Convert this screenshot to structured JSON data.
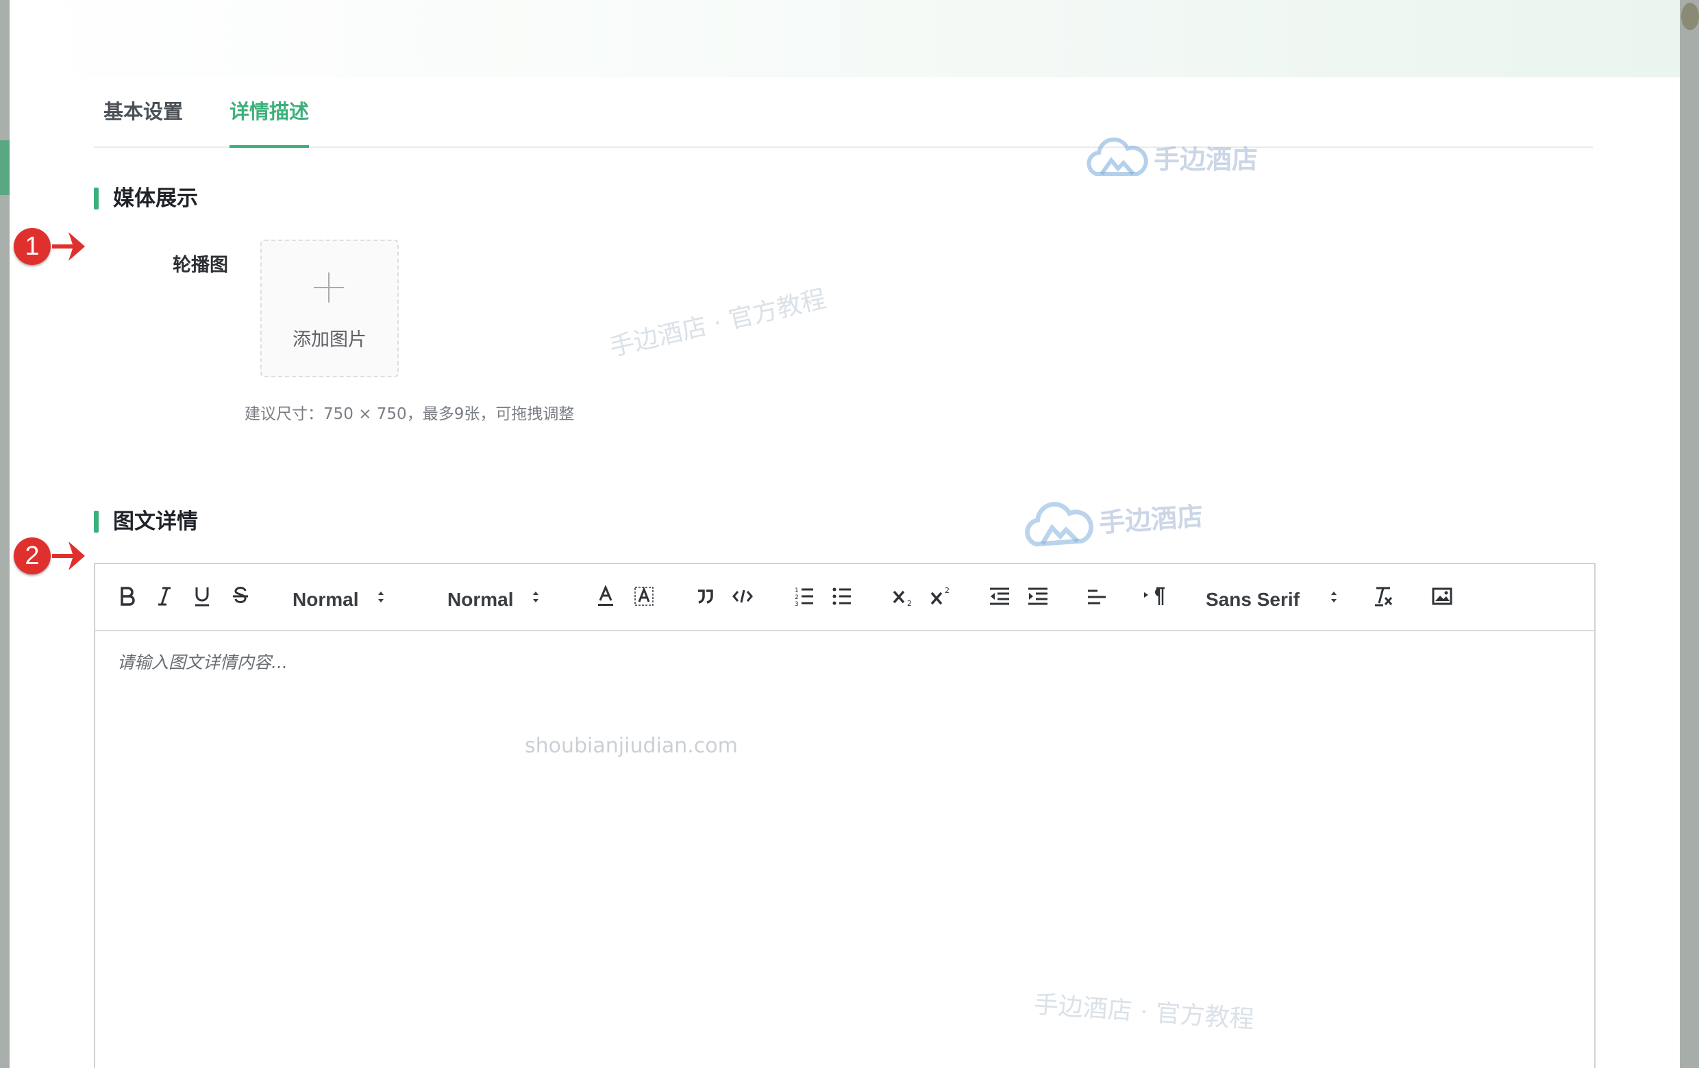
{
  "tabs": [
    {
      "label": "基本设置",
      "active": false
    },
    {
      "label": "详情描述",
      "active": true
    }
  ],
  "media_section": {
    "title": "媒体展示",
    "carousel_label": "轮播图",
    "upload_text": "添加图片",
    "hint": "建议尺寸：750 × 750，最多9张，可拖拽调整"
  },
  "detail_section": {
    "title": "图文详情",
    "editor": {
      "header_picker": "Normal",
      "size_picker": "Normal",
      "font_picker": "Sans Serif",
      "placeholder": "请输入图文详情内容..."
    }
  },
  "toolbar_icons": [
    "bold-icon",
    "italic-icon",
    "underline-icon",
    "strike-icon",
    "text-color-icon",
    "background-color-icon",
    "blockquote-icon",
    "code-block-icon",
    "ordered-list-icon",
    "bullet-list-icon",
    "subscript-icon",
    "superscript-icon",
    "outdent-icon",
    "indent-icon",
    "align-icon",
    "text-direction-icon",
    "clean-format-icon",
    "image-icon"
  ],
  "watermarks": {
    "logo_text": "手边酒店",
    "tutorial_text": "手边酒店 · 官方教程",
    "domain": "shoubianjiudian.com"
  },
  "steps": [
    "1",
    "2"
  ],
  "colors": {
    "accent": "#3cb07b",
    "marker": "#e0302d"
  }
}
